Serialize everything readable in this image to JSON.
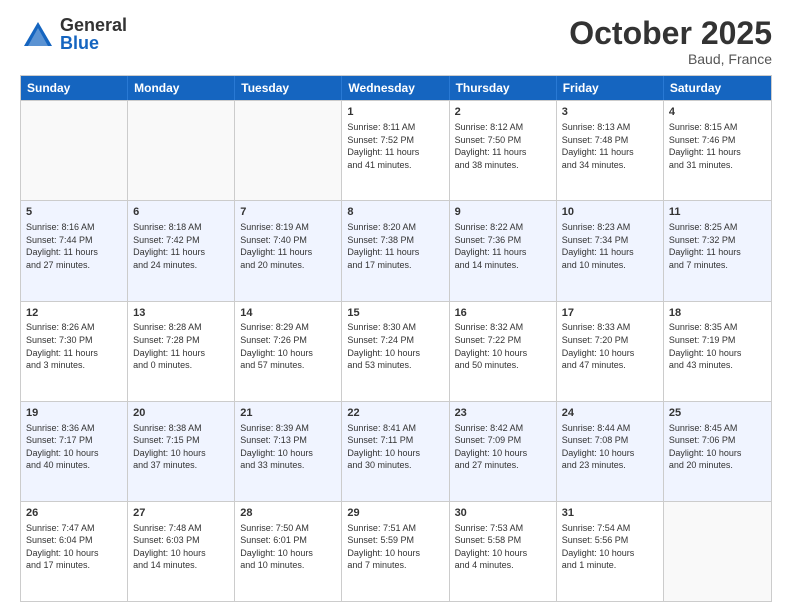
{
  "header": {
    "logo_general": "General",
    "logo_blue": "Blue",
    "month_title": "October 2025",
    "location": "Baud, France"
  },
  "weekdays": [
    "Sunday",
    "Monday",
    "Tuesday",
    "Wednesday",
    "Thursday",
    "Friday",
    "Saturday"
  ],
  "rows": [
    [
      {
        "day": "",
        "info": ""
      },
      {
        "day": "",
        "info": ""
      },
      {
        "day": "",
        "info": ""
      },
      {
        "day": "1",
        "info": "Sunrise: 8:11 AM\nSunset: 7:52 PM\nDaylight: 11 hours\nand 41 minutes."
      },
      {
        "day": "2",
        "info": "Sunrise: 8:12 AM\nSunset: 7:50 PM\nDaylight: 11 hours\nand 38 minutes."
      },
      {
        "day": "3",
        "info": "Sunrise: 8:13 AM\nSunset: 7:48 PM\nDaylight: 11 hours\nand 34 minutes."
      },
      {
        "day": "4",
        "info": "Sunrise: 8:15 AM\nSunset: 7:46 PM\nDaylight: 11 hours\nand 31 minutes."
      }
    ],
    [
      {
        "day": "5",
        "info": "Sunrise: 8:16 AM\nSunset: 7:44 PM\nDaylight: 11 hours\nand 27 minutes."
      },
      {
        "day": "6",
        "info": "Sunrise: 8:18 AM\nSunset: 7:42 PM\nDaylight: 11 hours\nand 24 minutes."
      },
      {
        "day": "7",
        "info": "Sunrise: 8:19 AM\nSunset: 7:40 PM\nDaylight: 11 hours\nand 20 minutes."
      },
      {
        "day": "8",
        "info": "Sunrise: 8:20 AM\nSunset: 7:38 PM\nDaylight: 11 hours\nand 17 minutes."
      },
      {
        "day": "9",
        "info": "Sunrise: 8:22 AM\nSunset: 7:36 PM\nDaylight: 11 hours\nand 14 minutes."
      },
      {
        "day": "10",
        "info": "Sunrise: 8:23 AM\nSunset: 7:34 PM\nDaylight: 11 hours\nand 10 minutes."
      },
      {
        "day": "11",
        "info": "Sunrise: 8:25 AM\nSunset: 7:32 PM\nDaylight: 11 hours\nand 7 minutes."
      }
    ],
    [
      {
        "day": "12",
        "info": "Sunrise: 8:26 AM\nSunset: 7:30 PM\nDaylight: 11 hours\nand 3 minutes."
      },
      {
        "day": "13",
        "info": "Sunrise: 8:28 AM\nSunset: 7:28 PM\nDaylight: 11 hours\nand 0 minutes."
      },
      {
        "day": "14",
        "info": "Sunrise: 8:29 AM\nSunset: 7:26 PM\nDaylight: 10 hours\nand 57 minutes."
      },
      {
        "day": "15",
        "info": "Sunrise: 8:30 AM\nSunset: 7:24 PM\nDaylight: 10 hours\nand 53 minutes."
      },
      {
        "day": "16",
        "info": "Sunrise: 8:32 AM\nSunset: 7:22 PM\nDaylight: 10 hours\nand 50 minutes."
      },
      {
        "day": "17",
        "info": "Sunrise: 8:33 AM\nSunset: 7:20 PM\nDaylight: 10 hours\nand 47 minutes."
      },
      {
        "day": "18",
        "info": "Sunrise: 8:35 AM\nSunset: 7:19 PM\nDaylight: 10 hours\nand 43 minutes."
      }
    ],
    [
      {
        "day": "19",
        "info": "Sunrise: 8:36 AM\nSunset: 7:17 PM\nDaylight: 10 hours\nand 40 minutes."
      },
      {
        "day": "20",
        "info": "Sunrise: 8:38 AM\nSunset: 7:15 PM\nDaylight: 10 hours\nand 37 minutes."
      },
      {
        "day": "21",
        "info": "Sunrise: 8:39 AM\nSunset: 7:13 PM\nDaylight: 10 hours\nand 33 minutes."
      },
      {
        "day": "22",
        "info": "Sunrise: 8:41 AM\nSunset: 7:11 PM\nDaylight: 10 hours\nand 30 minutes."
      },
      {
        "day": "23",
        "info": "Sunrise: 8:42 AM\nSunset: 7:09 PM\nDaylight: 10 hours\nand 27 minutes."
      },
      {
        "day": "24",
        "info": "Sunrise: 8:44 AM\nSunset: 7:08 PM\nDaylight: 10 hours\nand 23 minutes."
      },
      {
        "day": "25",
        "info": "Sunrise: 8:45 AM\nSunset: 7:06 PM\nDaylight: 10 hours\nand 20 minutes."
      }
    ],
    [
      {
        "day": "26",
        "info": "Sunrise: 7:47 AM\nSunset: 6:04 PM\nDaylight: 10 hours\nand 17 minutes."
      },
      {
        "day": "27",
        "info": "Sunrise: 7:48 AM\nSunset: 6:03 PM\nDaylight: 10 hours\nand 14 minutes."
      },
      {
        "day": "28",
        "info": "Sunrise: 7:50 AM\nSunset: 6:01 PM\nDaylight: 10 hours\nand 10 minutes."
      },
      {
        "day": "29",
        "info": "Sunrise: 7:51 AM\nSunset: 5:59 PM\nDaylight: 10 hours\nand 7 minutes."
      },
      {
        "day": "30",
        "info": "Sunrise: 7:53 AM\nSunset: 5:58 PM\nDaylight: 10 hours\nand 4 minutes."
      },
      {
        "day": "31",
        "info": "Sunrise: 7:54 AM\nSunset: 5:56 PM\nDaylight: 10 hours\nand 1 minute."
      },
      {
        "day": "",
        "info": ""
      }
    ]
  ],
  "alt_rows": [
    1,
    3
  ]
}
